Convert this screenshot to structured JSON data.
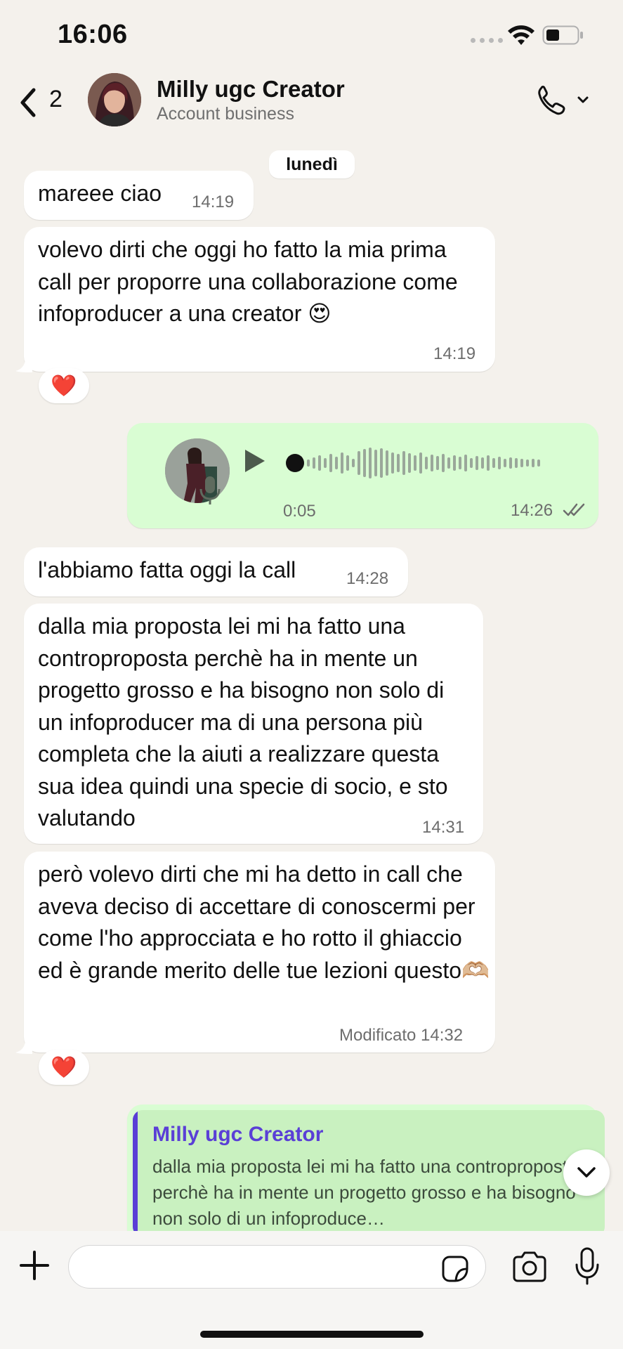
{
  "status_bar": {
    "time": "16:06"
  },
  "header": {
    "back_count": "2",
    "contact_name": "Milly ugc Creator",
    "contact_subtitle": "Account business"
  },
  "date_chip": "lunedì",
  "messages": [
    {
      "text": "mareee ciao",
      "time": "14:19"
    },
    {
      "text": "volevo dirti che oggi ho fatto la mia prima call per proporre una collaborazione come infoproducer a una creator 😍",
      "time": "14:19",
      "reaction": "❤️"
    },
    {
      "type": "voice",
      "duration": "0:05",
      "time": "14:26"
    },
    {
      "text": "l'abbiamo fatta oggi la call",
      "time": "14:28"
    },
    {
      "text": "dalla mia proposta lei mi ha fatto una controproposta perchè ha in mente un progetto grosso e ha bisogno non solo di un infoproducer ma di una persona più completa che la aiuti a realizzare questa sua idea quindi una specie di socio, e sto valutando",
      "time": "14:31"
    },
    {
      "text": "però volevo dirti che mi ha detto in call che aveva deciso di accettare di conoscermi per come l'ho approcciata e ho rotto il ghiaccio ed è grande merito delle tue lezioni questo🫶🏼",
      "time": "Modificato 14:32",
      "reaction": "❤️"
    }
  ],
  "reply_quote": {
    "name": "Milly ugc Creator",
    "text": "dalla mia proposta lei mi ha fatto una controproposta perchè ha in mente un progetto grosso e ha bisogno non solo di un infoproduce…"
  },
  "composer": {
    "placeholder": ""
  },
  "colors": {
    "incoming": "#ffffff",
    "outgoing": "#d9fdd3",
    "background": "#f4f1ec",
    "quote_accent": "#5a3fd6",
    "reaction_heart": "#e0162b"
  },
  "icons": [
    "back-chevron-icon",
    "phone-icon",
    "chevron-down-icon",
    "play-icon",
    "mic-icon",
    "read-receipt-icon",
    "plus-icon",
    "sticker-icon",
    "camera-icon",
    "wifi-icon",
    "battery-icon"
  ]
}
